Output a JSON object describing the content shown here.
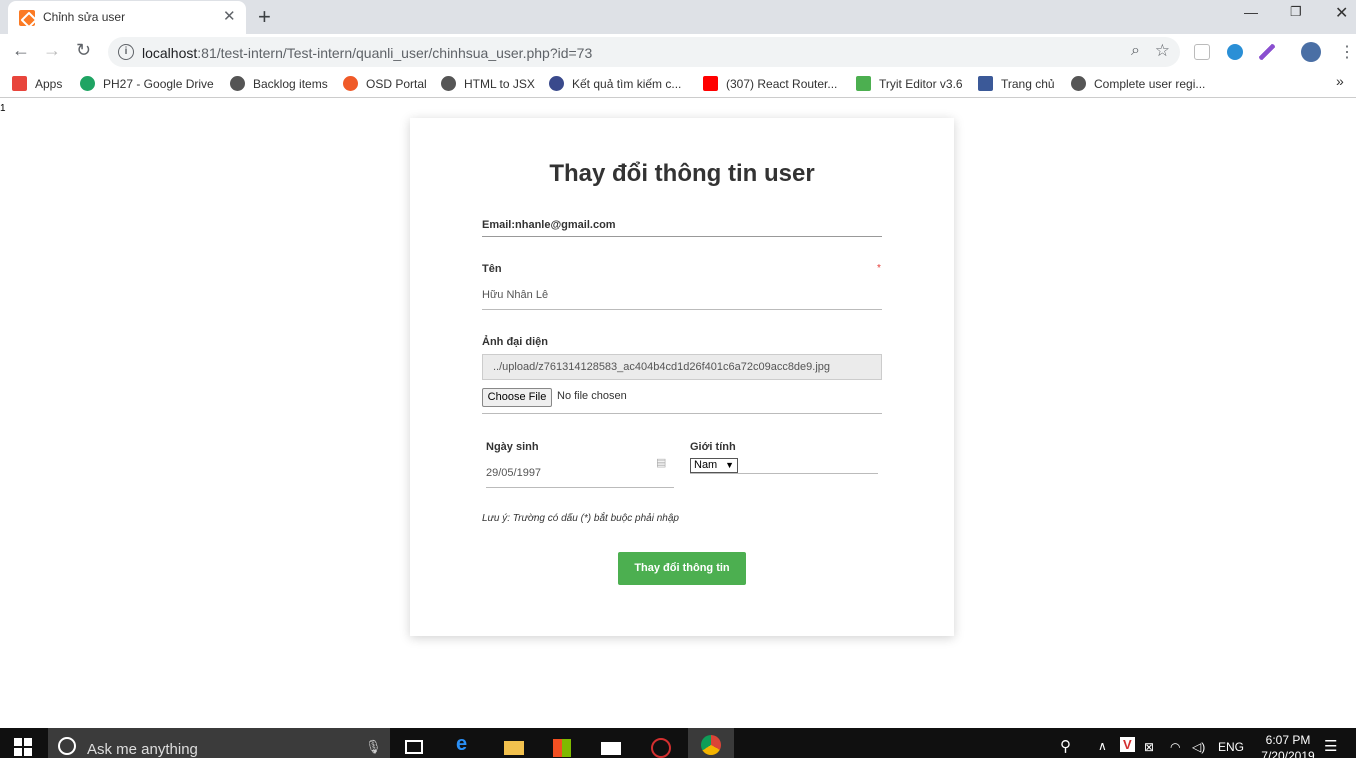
{
  "browser": {
    "tab_title": "Chỉnh sửa user",
    "url_host": "localhost",
    "url_rest": ":81/test-intern/Test-intern/quanli_user/chinhsua_user.php?id=73",
    "bookmarks": [
      {
        "label": "Apps",
        "icon": "apps-grid-icon",
        "color": "#e8453c"
      },
      {
        "label": "PH27 - Google Drive",
        "icon": "google-drive-icon",
        "color": "#1fa463"
      },
      {
        "label": "Backlog items",
        "icon": "globe-icon",
        "color": "#555555"
      },
      {
        "label": "OSD Portal",
        "icon": "osd-portal-icon",
        "color": "#f05a28"
      },
      {
        "label": "HTML to JSX",
        "icon": "globe-icon",
        "color": "#555555"
      },
      {
        "label": "Kết quả tìm kiếm c...",
        "icon": "shield-icon",
        "color": "#3a4a8c"
      },
      {
        "label": "(307) React Router...",
        "icon": "youtube-icon",
        "color": "#ff0000"
      },
      {
        "label": "Tryit Editor v3.6",
        "icon": "w3schools-icon",
        "color": "#4caf50"
      },
      {
        "label": "Trang chủ",
        "icon": "facebook-icon",
        "color": "#3b5998"
      },
      {
        "label": "Complete user regi...",
        "icon": "globe-icon",
        "color": "#555555"
      }
    ],
    "overflow": "»"
  },
  "page": {
    "stray_text": "1",
    "heading": "Thay đổi thông tin user",
    "email_label": "Email:nhanle@gmail.com",
    "name_label": "Tên",
    "name_required_mark": "*",
    "name_value": "Hữu Nhân Lê",
    "avatar_label": "Ảnh đại diện",
    "avatar_path": "../upload/z761314128583_ac404b4cd1d26f401c6a72c09acc8de9.jpg",
    "choose_file": "Choose File",
    "no_file": "No file chosen",
    "dob_label": "Ngày sinh",
    "dob_value": "29/05/1997",
    "gender_label": "Giới tính",
    "gender_value": "Nam",
    "note": "Lưu ý: Trường có dấu (*) bắt buộc phải nhập",
    "submit": "Thay đổi thông tin",
    "accent_color": "#4caf50"
  },
  "taskbar": {
    "search_placeholder": "Ask me anything",
    "lang": "ENG",
    "time": "6:07 PM",
    "date": "7/20/2019"
  }
}
